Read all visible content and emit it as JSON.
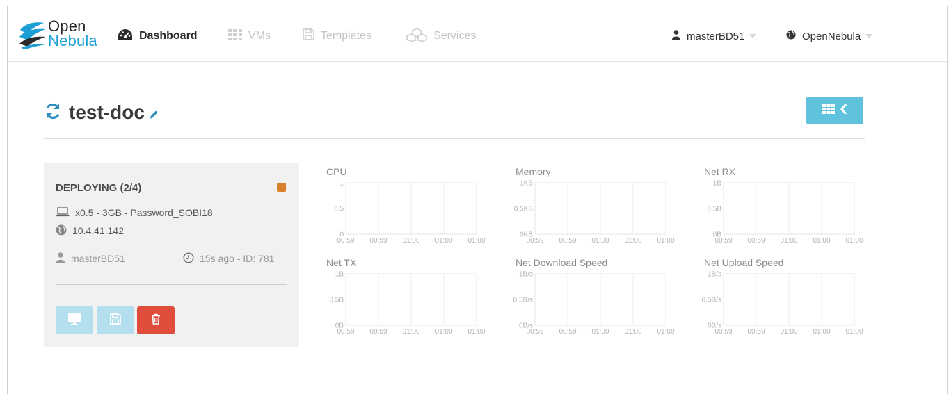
{
  "brand": {
    "open": "Open",
    "nebula": "Nebula"
  },
  "nav": {
    "dashboard": {
      "label": "Dashboard",
      "icon": "dashboard-icon"
    },
    "vms": {
      "label": "VMs",
      "icon": "grid-icon"
    },
    "templates": {
      "label": "Templates",
      "icon": "floppy-icon"
    },
    "services": {
      "label": "Services",
      "icon": "cubes-icon"
    },
    "user": {
      "label": "masterBD51",
      "icon": "user-icon"
    },
    "zone": {
      "label": "OpenNebula",
      "icon": "globe-icon"
    }
  },
  "page": {
    "title": "test-doc"
  },
  "vm": {
    "state": "DEPLOYING (2/4)",
    "state_color": "#d9822b",
    "template_info": "x0.5 - 3GB - Password_SOBI18",
    "ip": "10.4.41.142",
    "owner": "masterBD51",
    "age_id": "15s ago - ID: 781"
  },
  "colors": {
    "accent": "#5fc3de",
    "accent_light": "#b4dfee",
    "danger": "#e04d3d"
  },
  "chart_data": [
    {
      "type": "line",
      "title": "CPU",
      "x": [
        "00:59",
        "00:59",
        "01:00",
        "01:00",
        "01:00"
      ],
      "yticks": [
        "1",
        "0.5",
        "0"
      ],
      "ylim": [
        0,
        1
      ],
      "series": []
    },
    {
      "type": "line",
      "title": "Memory",
      "x": [
        "00:59",
        "00:59",
        "01:00",
        "01:00",
        "01:00"
      ],
      "yticks": [
        "1KB",
        "0.5KB",
        "0KB"
      ],
      "ylim": [
        0,
        1
      ],
      "series": []
    },
    {
      "type": "line",
      "title": "Net RX",
      "x": [
        "00:59",
        "00:59",
        "01:00",
        "01:00",
        "01:00"
      ],
      "yticks": [
        "1B",
        "0.5B",
        "0B"
      ],
      "ylim": [
        0,
        1
      ],
      "series": []
    },
    {
      "type": "line",
      "title": "Net TX",
      "x": [
        "00:59",
        "00:59",
        "01:00",
        "01:00",
        "01:00"
      ],
      "yticks": [
        "1B",
        "0.5B",
        "0B"
      ],
      "ylim": [
        0,
        1
      ],
      "series": []
    },
    {
      "type": "line",
      "title": "Net Download Speed",
      "x": [
        "00:59",
        "00:59",
        "01:00",
        "01:00",
        "01:00"
      ],
      "yticks": [
        "1B/s",
        "0.5B/s",
        "0B/s"
      ],
      "ylim": [
        0,
        1
      ],
      "series": []
    },
    {
      "type": "line",
      "title": "Net Upload Speed",
      "x": [
        "00:59",
        "00:59",
        "01:00",
        "01:00",
        "01:00"
      ],
      "yticks": [
        "1B/s",
        "0.5B/s",
        "0B/s"
      ],
      "ylim": [
        0,
        1
      ],
      "series": []
    }
  ]
}
